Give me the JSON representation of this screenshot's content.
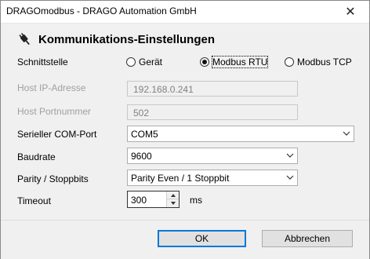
{
  "window": {
    "title": "DRAGOmodbus - DRAGO Automation GmbH",
    "close_glyph": "✕"
  },
  "heading": {
    "text": "Kommunikations-Einstellungen",
    "icon": "plug-icon"
  },
  "interface": {
    "label": "Schnittstelle",
    "options": [
      {
        "label": "Gerät",
        "checked": false
      },
      {
        "label": "Modbus RTU",
        "checked": true
      },
      {
        "label": "Modbus TCP",
        "checked": false
      }
    ]
  },
  "host_ip": {
    "label": "Host IP-Adresse",
    "value": "192.168.0.241",
    "disabled": true
  },
  "host_port": {
    "label": "Host Portnummer",
    "value": "502",
    "disabled": true
  },
  "com_port": {
    "label": "Serieller COM-Port",
    "value": "COM5"
  },
  "baudrate": {
    "label": "Baudrate",
    "value": "9600"
  },
  "parity": {
    "label": "Parity / Stoppbits",
    "value": "Parity Even / 1 Stoppbit"
  },
  "timeout": {
    "label": "Timeout",
    "value": "300",
    "unit": "ms"
  },
  "buttons": {
    "ok": "OK",
    "cancel": "Abbrechen"
  },
  "colors": {
    "default_button_border": "#0078d7",
    "disabled_text": "#a0a0a0"
  }
}
